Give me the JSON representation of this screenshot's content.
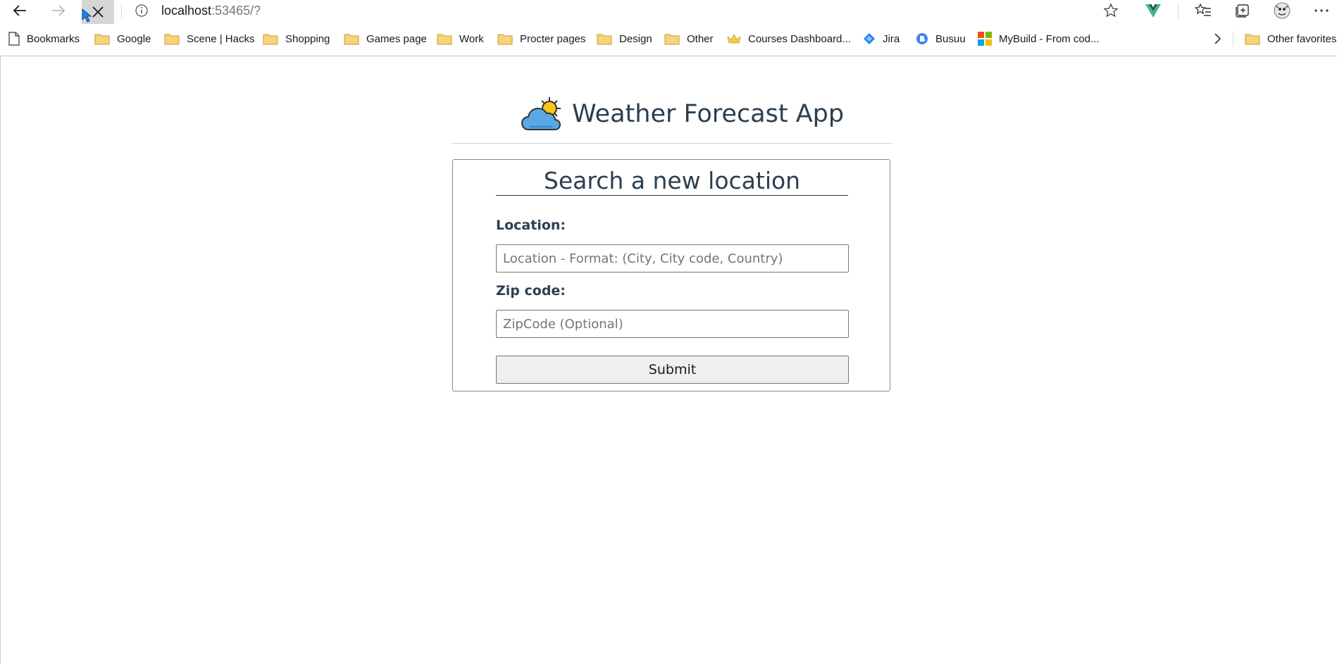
{
  "browser": {
    "address_host": "localhost",
    "address_rest": ":53465/?",
    "bookmarks": [
      {
        "label": "Bookmarks",
        "icon": "page-icon"
      },
      {
        "label": "Google",
        "icon": "folder-icon"
      },
      {
        "label": "Scene | Hacks",
        "icon": "folder-icon"
      },
      {
        "label": "Shopping",
        "icon": "folder-icon"
      },
      {
        "label": "Games page",
        "icon": "folder-icon"
      },
      {
        "label": "Work",
        "icon": "folder-icon"
      },
      {
        "label": "Procter pages",
        "icon": "folder-icon"
      },
      {
        "label": "Design",
        "icon": "folder-icon"
      },
      {
        "label": "Other",
        "icon": "folder-icon"
      },
      {
        "label": "Courses Dashboard...",
        "icon": "crown-icon"
      },
      {
        "label": "Jira",
        "icon": "jira-icon"
      },
      {
        "label": "Busuu",
        "icon": "busuu-icon"
      },
      {
        "label": "MyBuild - From cod...",
        "icon": "microsoft-icon"
      }
    ],
    "other_favorites": "Other favorites"
  },
  "app": {
    "title": "Weather Forecast App",
    "logo_icon": "weather-cloud-sun-icon"
  },
  "form": {
    "heading": "Search a new location",
    "location_label": "Location:",
    "location_value": "",
    "location_placeholder": "Location - Format: (City, City code, Country)",
    "zip_label": "Zip code:",
    "zip_value": "",
    "zip_placeholder": "ZipCode (Optional)",
    "submit_label": "Submit"
  },
  "colors": {
    "heading": "#2c3e50",
    "folder": "#e8b84a",
    "vue": "#41b883",
    "sun": "#f5c518",
    "cloud": "#5aa9e6"
  }
}
